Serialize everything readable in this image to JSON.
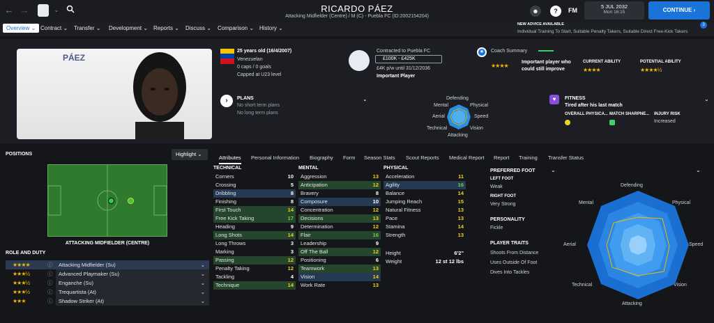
{
  "topbar": {
    "player_name": "RICARDO PÁEZ",
    "subtitle": "Attacking Midfielder (Centre) / M (C) - Puebla FC (ID:2002154204)",
    "date": "5 JUL 2032",
    "time": "Mon 16:15",
    "continue": "CONTINUE",
    "fm": "FM",
    "help": "?",
    "badge_count": "3"
  },
  "menu": [
    "Overview",
    "Contract",
    "Transfer",
    "Development",
    "Reports",
    "Discuss",
    "Comparison",
    "History"
  ],
  "advice": {
    "title": "NEW ADVICE AVAILABLE",
    "text": "Individual Training To Start, Suitable Penalty Takers, Suitable Direct Free-Kick Takers"
  },
  "profile": {
    "shirt_name": "PÁEZ",
    "age": "25 years old (16/4/2007)",
    "nationality": "Venezuelan",
    "caps": "0 caps / 0 goals",
    "capped": "Capped at U23 level"
  },
  "contract": {
    "title": "Contracted to Puebla FC",
    "value": "£100K - £425K",
    "wage": "£4K p/w until 31/12/2036",
    "status": "Important Player"
  },
  "coach": {
    "title": "Coach Summary",
    "summary": "Important player who could still improve",
    "current_label": "CURRENT ABILITY",
    "potential_label": "POTENTIAL ABILITY",
    "current_stars": 4,
    "potential_stars": 4.5,
    "summary_stars": 4
  },
  "plans": {
    "title": "PLANS",
    "short": "No short term plans",
    "long": "No long term plans"
  },
  "radar_small": {
    "labels": {
      "top": "Defending",
      "tl": "Mental",
      "tr": "Physical",
      "l": "Aerial",
      "r": "Speed",
      "bl": "Technical",
      "br": "Vision",
      "b": "Attacking"
    }
  },
  "fitness": {
    "title": "FITNESS",
    "summary": "Tired after his last match",
    "overall_label": "OVERALL PHYSICA...",
    "match_label": "MATCH SHARPNE...",
    "injury_label": "INJURY RISK",
    "injury_value": "Increased"
  },
  "positions": {
    "title": "POSITIONS",
    "highlight": "Highlight",
    "position_name": "ATTACKING MIDFIELDER (CENTRE)"
  },
  "roles": {
    "title": "ROLE AND DUTY",
    "items": [
      {
        "stars": 4,
        "name": "Attacking Midfielder (Su)"
      },
      {
        "stars": 3.5,
        "name": "Advanced Playmaker (Su)"
      },
      {
        "stars": 3.5,
        "name": "Enganche (Su)"
      },
      {
        "stars": 3.5,
        "name": "Trequartista (At)"
      },
      {
        "stars": 3,
        "name": "Shadow Striker (At)"
      }
    ]
  },
  "tabs": [
    "Attributes",
    "Personal Information",
    "Biography",
    "Form",
    "Season Stats",
    "Scout Reports",
    "Medical Report",
    "Report",
    "Training",
    "Transfer Status"
  ],
  "attributes": {
    "technical_title": "TECHNICAL",
    "mental_title": "MENTAL",
    "physical_title": "PHYSICAL",
    "technical": [
      [
        "Corners",
        "10"
      ],
      [
        "Crossing",
        "5"
      ],
      [
        "Dribbling",
        "8"
      ],
      [
        "Finishing",
        "8"
      ],
      [
        "First Touch",
        "14"
      ],
      [
        "Free Kick Taking",
        "17"
      ],
      [
        "Heading",
        "9"
      ],
      [
        "Long Shots",
        "14"
      ],
      [
        "Long Throws",
        "3"
      ],
      [
        "Marking",
        "3"
      ],
      [
        "Passing",
        "12"
      ],
      [
        "Penalty Taking",
        "12"
      ],
      [
        "Tackling",
        "4"
      ],
      [
        "Technique",
        "14"
      ]
    ],
    "mental": [
      [
        "Aggression",
        "13"
      ],
      [
        "Anticipation",
        "12"
      ],
      [
        "Bravery",
        "8"
      ],
      [
        "Composure",
        "10"
      ],
      [
        "Concentration",
        "12"
      ],
      [
        "Decisions",
        "13"
      ],
      [
        "Determination",
        "12"
      ],
      [
        "Flair",
        "16"
      ],
      [
        "Leadership",
        "9"
      ],
      [
        "Off The Ball",
        "12"
      ],
      [
        "Positioning",
        "6"
      ],
      [
        "Teamwork",
        "13"
      ],
      [
        "Vision",
        "14"
      ],
      [
        "Work Rate",
        "13"
      ]
    ],
    "physical": [
      [
        "Acceleration",
        "11"
      ],
      [
        "Agility",
        "16"
      ],
      [
        "Balance",
        "14"
      ],
      [
        "Jumping Reach",
        "15"
      ],
      [
        "Natural Fitness",
        "13"
      ],
      [
        "Pace",
        "13"
      ],
      [
        "Stamina",
        "14"
      ],
      [
        "Strength",
        "13"
      ]
    ],
    "height_label": "Height",
    "height": "6'2\"",
    "weight_label": "Weight",
    "weight": "12 st 12 lbs"
  },
  "preferred": {
    "title": "PREFERRED FOOT",
    "left_label": "LEFT FOOT",
    "left": "Weak",
    "right_label": "RIGHT FOOT",
    "right": "Very Strong",
    "personality_label": "PERSONALITY",
    "personality": "Fickle",
    "traits_label": "PLAYER TRAITS",
    "traits": [
      "Shoots From Distance",
      "Uses Outside Of Foot",
      "Dives Into Tackles"
    ]
  },
  "radar_big": {
    "labels": {
      "top": "Defending",
      "tl": "Mental",
      "tr": "Physical",
      "l": "Aerial",
      "r": "Speed",
      "bl": "Technical",
      "br": "Vision",
      "b": "Attacking"
    }
  },
  "colors": {
    "accent": "#1a73d9",
    "star": "#f2b705",
    "highlight_row": "#26452d",
    "blue_row": "#263952"
  }
}
